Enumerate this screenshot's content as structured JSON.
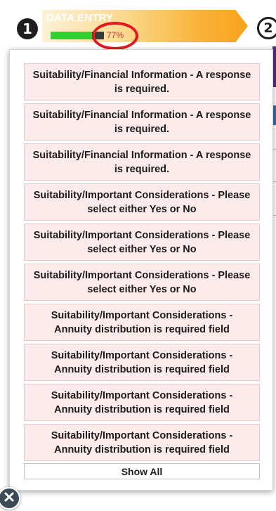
{
  "steps": {
    "current_number": "1",
    "current_title": "DATA ENTRY",
    "progress_percent": 77,
    "progress_label": "77%",
    "next_number": "2"
  },
  "errors_popup": {
    "items": [
      {
        "label": "Suitability/Financial Information - A response is required."
      },
      {
        "label": "Suitability/Financial Information - A response is required."
      },
      {
        "label": "Suitability/Financial Information - A response is required."
      },
      {
        "label": "Suitability/Important Considerations - Please select either Yes or No"
      },
      {
        "label": "Suitability/Important Considerations - Please select either Yes or No"
      },
      {
        "label": "Suitability/Important Considerations - Please select either Yes or No"
      },
      {
        "label": "Suitability/Important Considerations - Annuity distribution is required field"
      },
      {
        "label": "Suitability/Important Considerations - Annuity distribution is required field"
      },
      {
        "label": "Suitability/Important Considerations - Annuity distribution is required field"
      },
      {
        "label": "Suitability/Important Considerations - Annuity distribution is required field"
      }
    ],
    "show_all_label": "Show All"
  },
  "icons": {
    "close": "close-icon"
  },
  "colors": {
    "step_gradient_end": "#f7a21b",
    "progress_fill": "#2ed12e",
    "progress_text": "#c73229",
    "highlight_ring": "#e4161e",
    "error_bg": "#fdeaea",
    "close_button": "#3b4a57"
  }
}
